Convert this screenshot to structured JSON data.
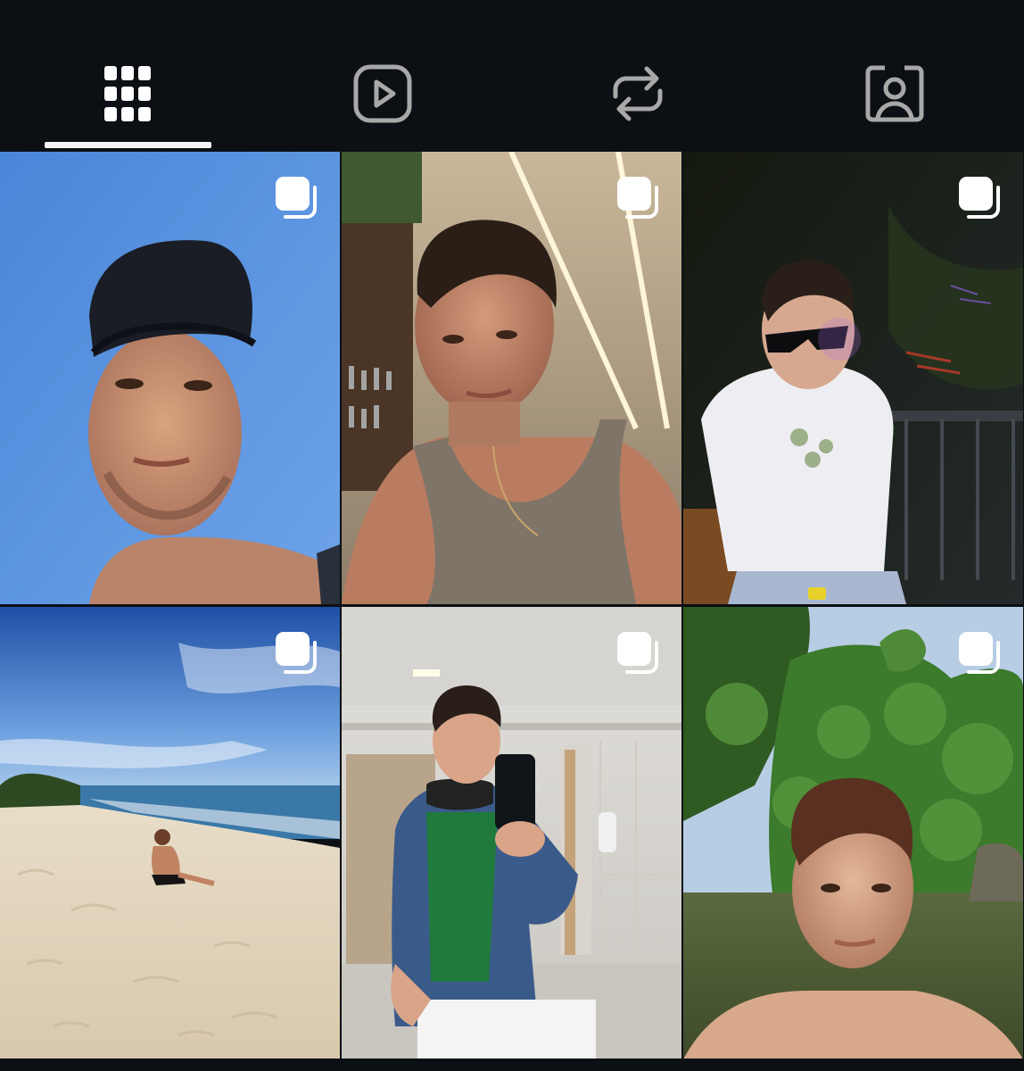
{
  "tabs": [
    {
      "name": "posts-grid",
      "icon": "grid-icon",
      "selected": true
    },
    {
      "name": "reels",
      "icon": "play-square-icon",
      "selected": false
    },
    {
      "name": "reposts",
      "icon": "repost-icon",
      "selected": false
    },
    {
      "name": "tagged",
      "icon": "person-tag-icon",
      "selected": false
    }
  ],
  "colors": {
    "background": "#0c1014",
    "active_icon": "#ffffff",
    "inactive_icon": "#a8a8a8"
  },
  "posts": [
    {
      "scene": "selfie-cap-blue-sky",
      "type": "carousel"
    },
    {
      "scene": "selfie-tank-top-ceiling-lights",
      "type": "carousel"
    },
    {
      "scene": "night-sunglasses-white-tee",
      "type": "carousel"
    },
    {
      "scene": "beach-sitting-sand",
      "type": "carousel"
    },
    {
      "scene": "mirror-selfie-denim-jacket",
      "type": "carousel"
    },
    {
      "scene": "river-jungle-selfie",
      "type": "carousel"
    }
  ]
}
